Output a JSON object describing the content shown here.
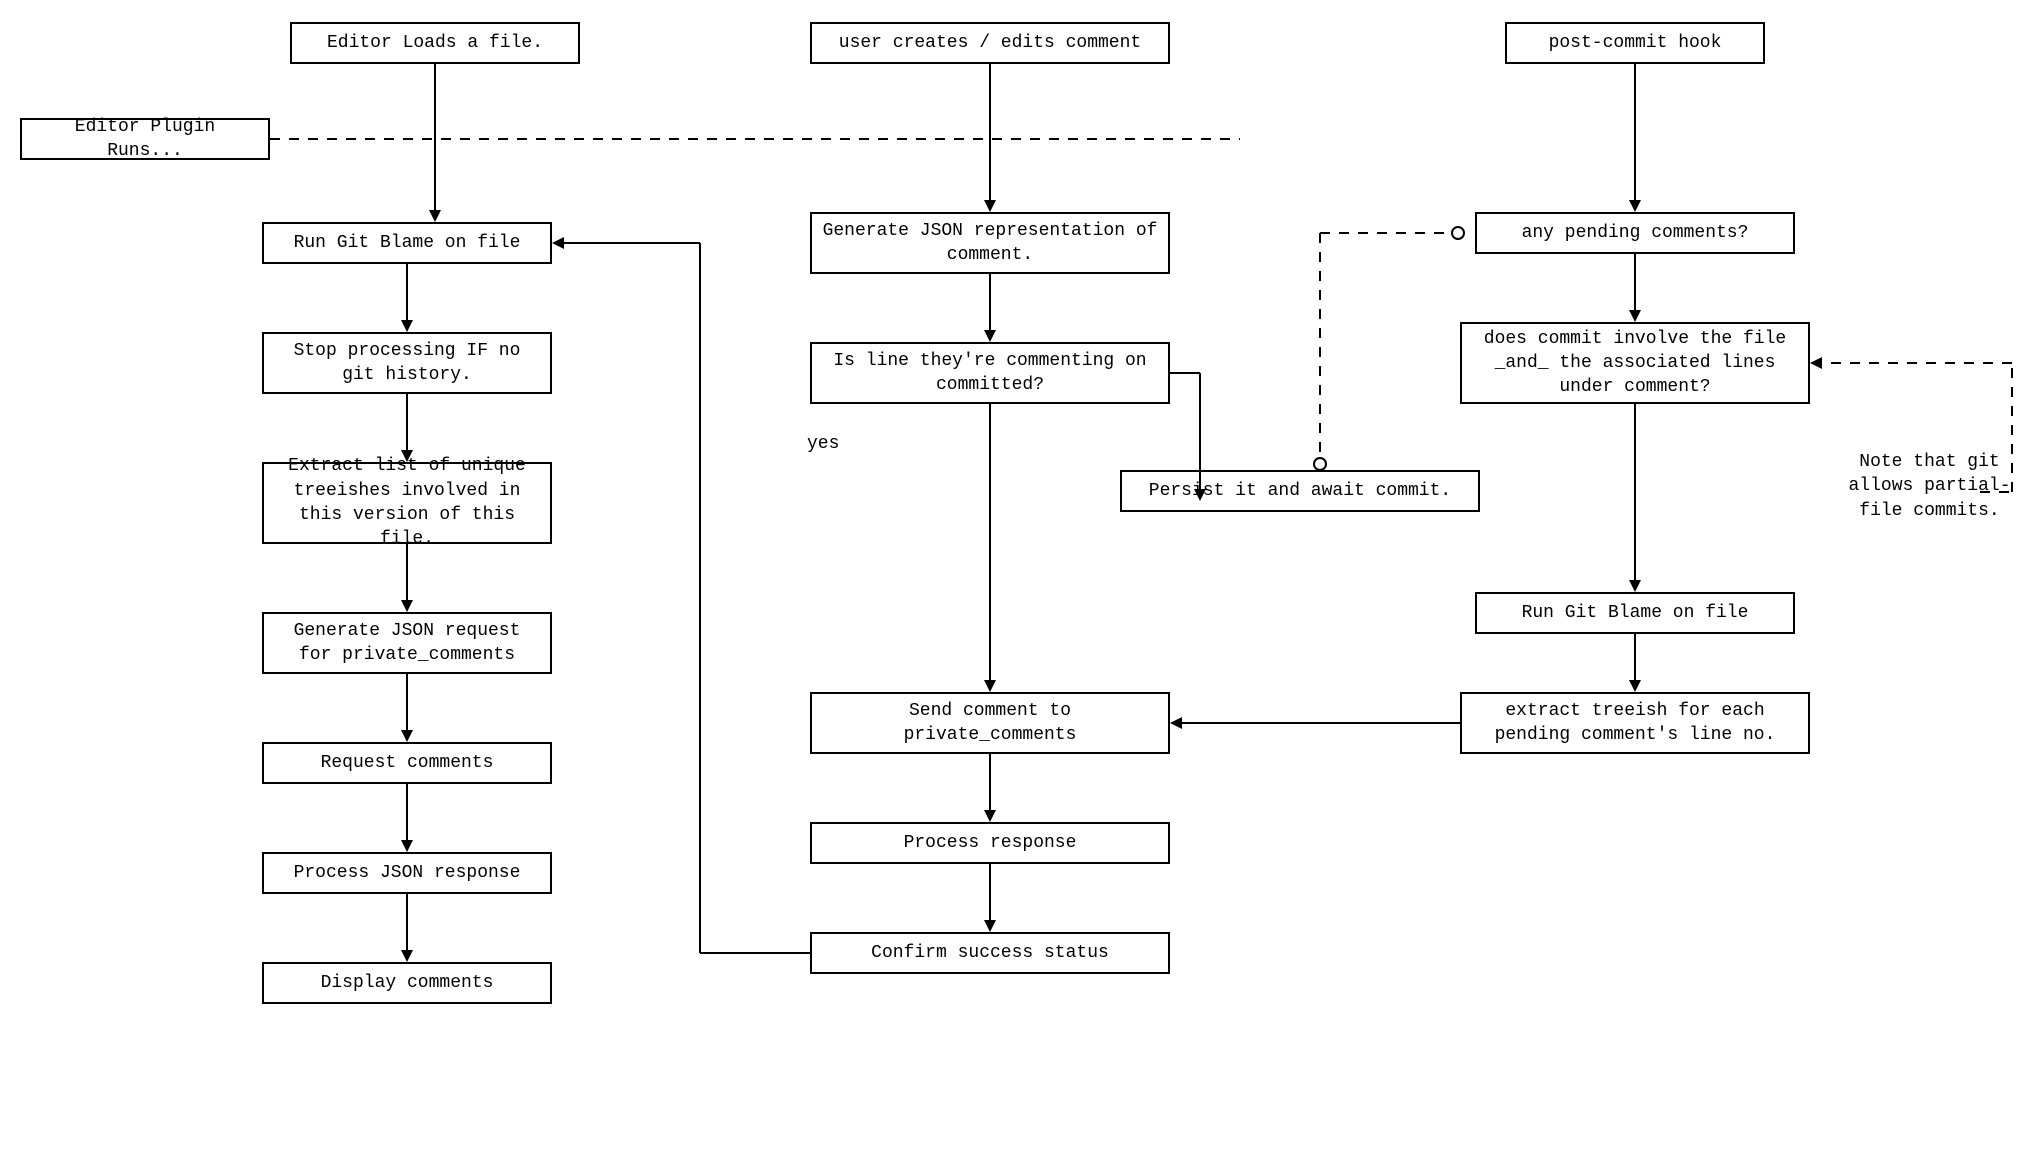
{
  "boxes": {
    "a1": "Editor Loads a file.",
    "a2": "Run Git Blame on file",
    "a3": "Stop processing IF no git history.",
    "a4": "Extract list of unique treeishes involved in this version of this file.",
    "a5": "Generate JSON request for private_comments",
    "a6": "Request comments",
    "a7": "Process JSON response",
    "a8": "Display comments",
    "plugin": "Editor Plugin Runs...",
    "b1": "user creates / edits comment",
    "b2": "Generate JSON representation of comment.",
    "b3": "Is line they're commenting on committed?",
    "b4": "Persist it and await commit.",
    "b5": "Send comment to private_comments",
    "b6": "Process response",
    "b7": "Confirm success status",
    "c1": "post-commit hook",
    "c2": "any pending comments?",
    "c3": "does commit involve the file _and_ the associated lines under comment?",
    "c4": "Run Git Blame on file",
    "c5": "extract treeish for each pending comment's line no."
  },
  "labels": {
    "yes": "yes",
    "note": "Note that git allows partial-file commits."
  }
}
